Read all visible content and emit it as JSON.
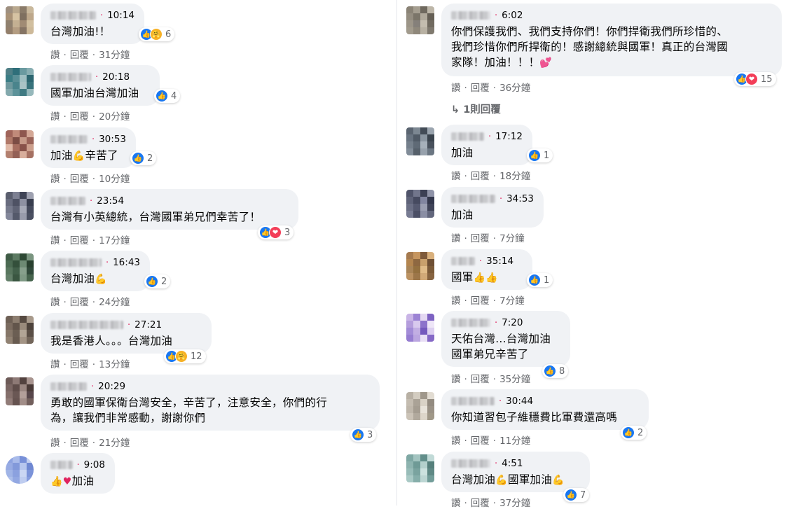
{
  "actions": {
    "like": "讚",
    "reply": "回覆"
  },
  "left_comments": [
    {
      "time": "10:14",
      "text": "台灣加油!！",
      "reactions": "6",
      "ago": "31分鐘"
    },
    {
      "time": "20:18",
      "text": "國軍加油台灣加油",
      "reactions": "4",
      "ago": "20分鐘"
    },
    {
      "time": "30:53",
      "text_a": "加油",
      "text_b": "辛苦了",
      "reactions": "2",
      "ago": "10分鐘"
    },
    {
      "time": "23:54",
      "text": "台灣有小英總統，台灣國軍弟兄們幸苦了！",
      "reactions": "3",
      "ago": "17分鐘"
    },
    {
      "time": "16:43",
      "text": "台灣加油",
      "reactions": "2",
      "ago": "24分鐘"
    },
    {
      "time": "27:21",
      "text": "我是香港人。。。台灣加油",
      "reactions": "12",
      "ago": "13分鐘"
    },
    {
      "time": "20:29",
      "text": "勇敢的國軍保衛台灣安全，辛苦了，注意安全，你們的行\n為，讓我們非常感動，謝謝你們",
      "reactions": "3",
      "ago": "21分鐘"
    },
    {
      "time": "9:08",
      "text": "加油",
      "reactions": "",
      "ago": ""
    }
  ],
  "right_comments": [
    {
      "time": "6:02",
      "text": "你們保護我們、我們支持你們！你們捍衛我們所珍惜的、\n我們珍惜你們所捍衛的！感謝總統與國軍！真正的台灣國\n家隊！加油！！！",
      "reactions": "15",
      "ago": "36分鐘"
    },
    {
      "time": "17:12",
      "text": "加油",
      "reactions": "1",
      "ago": "18分鐘"
    },
    {
      "time": "34:53",
      "text": "加油",
      "reactions": "",
      "ago": "7分鐘"
    },
    {
      "time": "35:14",
      "text": "國軍",
      "reactions": "1",
      "ago": "7分鐘"
    },
    {
      "time": "7:20",
      "text": "天佑台灣...台灣加油\n國軍弟兄辛苦了",
      "reactions": "8",
      "ago": "35分鐘"
    },
    {
      "time": "30:44",
      "text": "你知道習包子維穩費比軍費還高嗎",
      "reactions": "2",
      "ago": "11分鐘"
    },
    {
      "time": "4:51",
      "text_a": "台灣加油",
      "text_b": "國軍加油",
      "reactions": "7",
      "ago": "37分鐘"
    }
  ],
  "reply_toggle": "1則回覆",
  "icons": {
    "like": "like-icon",
    "care": "care-icon",
    "love": "love-icon",
    "reply_arrow": "reply-arrow-icon"
  },
  "colors": {
    "like": "#1877f2",
    "love": "#f33e58",
    "care": "#f7b125",
    "bubble": "#f0f2f5",
    "meta": "#65676b"
  }
}
